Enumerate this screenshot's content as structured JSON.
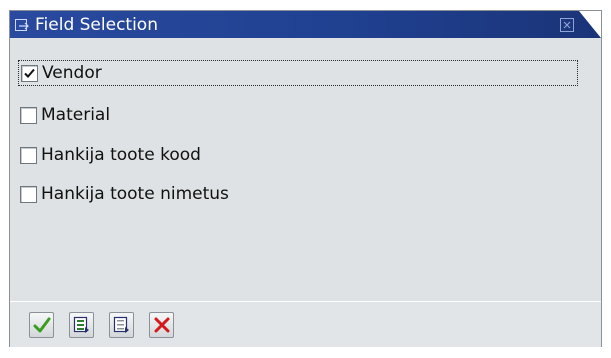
{
  "dialog": {
    "title": "Field Selection",
    "title_icon": "window-dialog-icon",
    "close_icon": "close-icon"
  },
  "fields": [
    {
      "label": "Vendor",
      "checked": true
    },
    {
      "label": "Material",
      "checked": false
    },
    {
      "label": "Hankija toote kood",
      "checked": false
    },
    {
      "label": "Hankija toote nimetus",
      "checked": false
    }
  ],
  "toolbar": {
    "buttons": [
      {
        "icon": "checkmark-icon"
      },
      {
        "icon": "select-all-icon"
      },
      {
        "icon": "deselect-all-icon"
      },
      {
        "icon": "cancel-x-icon"
      }
    ]
  },
  "colors": {
    "titlebar": "#2a4aa0",
    "dialog_bg": "#dee2e4",
    "confirm_green": "#3b9d1e",
    "cancel_red": "#d21a1a"
  }
}
